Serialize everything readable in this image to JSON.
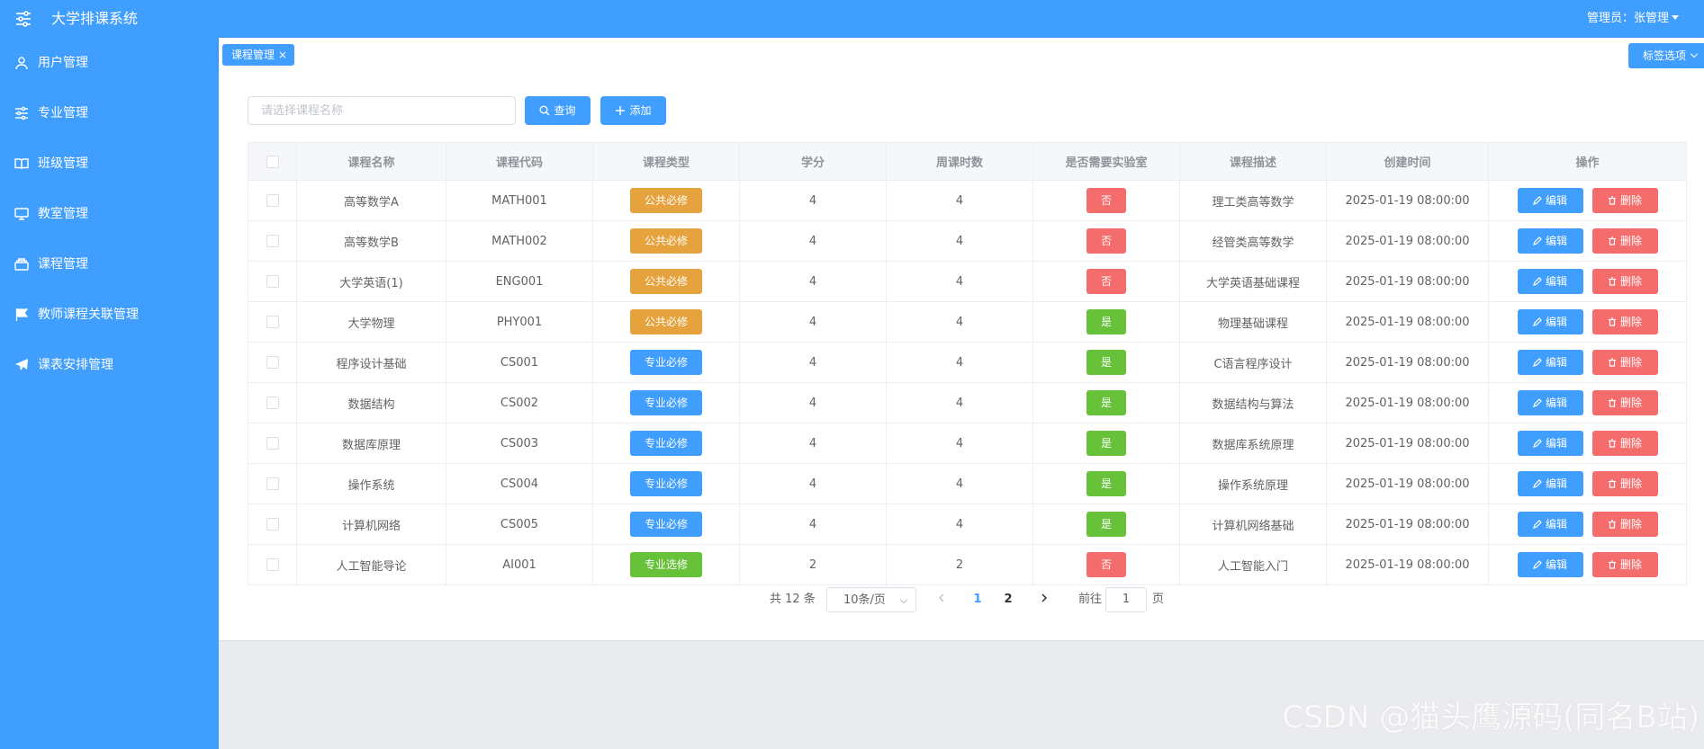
{
  "header": {
    "app_title": "大学排课系统",
    "user_label": "管理员：张管理",
    "menu_icon": "sliders-icon"
  },
  "sidebar": {
    "items": [
      {
        "label": "用户管理",
        "icon": "user-icon"
      },
      {
        "label": "专业管理",
        "icon": "sliders-icon"
      },
      {
        "label": "班级管理",
        "icon": "book-icon"
      },
      {
        "label": "教室管理",
        "icon": "monitor-icon"
      },
      {
        "label": "课程管理",
        "icon": "box-icon"
      },
      {
        "label": "教师课程关联管理",
        "icon": "flag-icon"
      },
      {
        "label": "课表安排管理",
        "icon": "send-icon"
      }
    ]
  },
  "tabs": {
    "active_tab": "课程管理",
    "close_glyph": "×",
    "options_label": "标签选项"
  },
  "toolbar": {
    "search_placeholder": "请选择课程名称",
    "search_value": "",
    "query_label": "查询",
    "add_label": "添加"
  },
  "table": {
    "headers": [
      "课程名称",
      "课程代码",
      "课程类型",
      "学分",
      "周课时数",
      "是否需要实验室",
      "课程描述",
      "创建时间",
      "操作"
    ],
    "edit_label": "编辑",
    "delete_label": "删除",
    "rows": [
      {
        "name": "高等数学A",
        "code": "MATH001",
        "type": "公共必修",
        "credit": "4",
        "hours": "4",
        "lab": "否",
        "desc": "理工类高等数学",
        "created": "2025-01-19 08:00:00"
      },
      {
        "name": "高等数学B",
        "code": "MATH002",
        "type": "公共必修",
        "credit": "4",
        "hours": "4",
        "lab": "否",
        "desc": "经管类高等数学",
        "created": "2025-01-19 08:00:00"
      },
      {
        "name": "大学英语(1)",
        "code": "ENG001",
        "type": "公共必修",
        "credit": "4",
        "hours": "4",
        "lab": "否",
        "desc": "大学英语基础课程",
        "created": "2025-01-19 08:00:00"
      },
      {
        "name": "大学物理",
        "code": "PHY001",
        "type": "公共必修",
        "credit": "4",
        "hours": "4",
        "lab": "是",
        "desc": "物理基础课程",
        "created": "2025-01-19 08:00:00"
      },
      {
        "name": "程序设计基础",
        "code": "CS001",
        "type": "专业必修",
        "credit": "4",
        "hours": "4",
        "lab": "是",
        "desc": "C语言程序设计",
        "created": "2025-01-19 08:00:00"
      },
      {
        "name": "数据结构",
        "code": "CS002",
        "type": "专业必修",
        "credit": "4",
        "hours": "4",
        "lab": "是",
        "desc": "数据结构与算法",
        "created": "2025-01-19 08:00:00"
      },
      {
        "name": "数据库原理",
        "code": "CS003",
        "type": "专业必修",
        "credit": "4",
        "hours": "4",
        "lab": "是",
        "desc": "数据库系统原理",
        "created": "2025-01-19 08:00:00"
      },
      {
        "name": "操作系统",
        "code": "CS004",
        "type": "专业必修",
        "credit": "4",
        "hours": "4",
        "lab": "是",
        "desc": "操作系统原理",
        "created": "2025-01-19 08:00:00"
      },
      {
        "name": "计算机网络",
        "code": "CS005",
        "type": "专业必修",
        "credit": "4",
        "hours": "4",
        "lab": "是",
        "desc": "计算机网络基础",
        "created": "2025-01-19 08:00:00"
      },
      {
        "name": "人工智能导论",
        "code": "AI001",
        "type": "专业选修",
        "credit": "2",
        "hours": "2",
        "lab": "否",
        "desc": "人工智能入门",
        "created": "2025-01-19 08:00:00"
      }
    ]
  },
  "colors": {
    "primary": "#409eff",
    "public_required": "#e6a23c",
    "major_required": "#409eff",
    "major_elective": "#67c23a",
    "lab_yes": "#67c23a",
    "lab_no": "#f56c6c",
    "danger": "#f56c6c"
  },
  "pagination": {
    "total_label": "共 12 条",
    "page_size": "10条/页",
    "pages": [
      "1",
      "2"
    ],
    "current_page": "1",
    "goto_label": "前往",
    "goto_value": "1",
    "page_suffix": "页"
  },
  "watermark": "CSDN @猫头鹰源码(同名B站)"
}
